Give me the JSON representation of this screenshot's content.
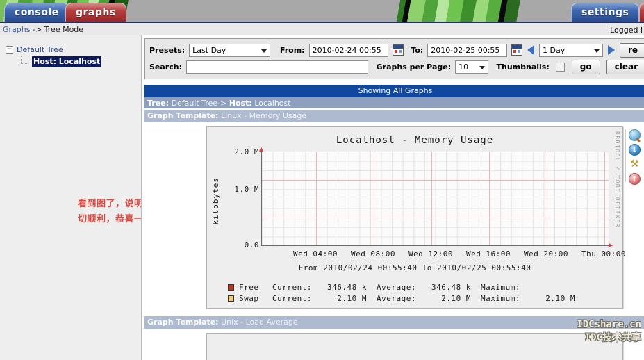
{
  "banner": {
    "tabs": [
      {
        "id": "console",
        "label": "console",
        "active": false
      },
      {
        "id": "graphs",
        "label": "graphs",
        "active": true
      },
      {
        "id": "settings",
        "label": "settings",
        "active": false
      }
    ],
    "accent_blue": "#274b8e",
    "accent_red": "#9c2626"
  },
  "breadcrumb": {
    "link": "Graphs",
    "arrow": " -> ",
    "mode": "Tree Mode",
    "logged_in": "Logged i"
  },
  "sidebar": {
    "tree": {
      "root_label": "Default Tree",
      "toggle_glyph": "−",
      "child_label": "Host: Localhost"
    },
    "annotation_line1": "看到图了，说明安装一",
    "annotation_line2": "切顺利，恭喜一下！",
    "annotation_color": "#d6483f"
  },
  "filter": {
    "presets_label": "Presets:",
    "presets_value": "Last Day",
    "from_label": "From:",
    "from_value": "2010-02-24 00:55",
    "to_label": "To:",
    "to_value": "2010-02-25 00:55",
    "interval_value": "1 Day",
    "refresh_label": "re",
    "search_label": "Search:",
    "search_value": "",
    "search_placeholder": "",
    "graphs_per_page_label": "Graphs per Page:",
    "graphs_per_page_value": "10",
    "thumbnails_label": "Thumbnails:",
    "go_label": "go",
    "clear_label": "clear"
  },
  "content": {
    "showing_all": "Showing All Graphs",
    "tree_bar": {
      "tree_key": "Tree:",
      "tree_value": "Default Tree->",
      "host_key": "Host:",
      "host_value": "Localhost"
    },
    "template_bar_1": {
      "key": "Graph Template:",
      "value": "Linux - Memory Usage"
    },
    "template_bar_2": {
      "key": "Graph Template:",
      "value": "Unix - Load Average"
    }
  },
  "chart_data": {
    "type": "line",
    "title": "Localhost - Memory Usage",
    "ylabel": "kilobytes",
    "xlabel": "",
    "grid": true,
    "watermark": "RRDTOOL / TOBI OETIKER",
    "range_text": "From 2010/02/24 00:55:40 To 2010/02/25 00:55:40",
    "ylim": [
      0,
      2400000
    ],
    "yticks": [
      "0.0",
      "1.0 M",
      "2.0 M"
    ],
    "ytick_values": [
      0,
      1000000,
      2000000
    ],
    "xticks": [
      "Wed 04:00",
      "Wed 08:00",
      "Wed 12:00",
      "Wed 16:00",
      "Wed 20:00",
      "Thu 00:00"
    ],
    "series": [
      {
        "name": "Free",
        "color": "#b83a1e",
        "current": "346.48 k",
        "average": "346.48 k",
        "maximum": "",
        "values": []
      },
      {
        "name": "Swap",
        "color": "#f2cc7a",
        "current": "2.10 M",
        "average": "2.10 M",
        "maximum": "2.10 M",
        "values": []
      }
    ],
    "legend_headers": {
      "current": "Current:",
      "average": "Average:",
      "maximum": "Maximum:"
    }
  },
  "site_watermark": {
    "line1": "IDCshare.cn",
    "line2": "IDC技术共享"
  },
  "icons": {
    "zoom": "zoom-icon",
    "down": "↓",
    "wrench": "⚒",
    "up": "↑"
  }
}
